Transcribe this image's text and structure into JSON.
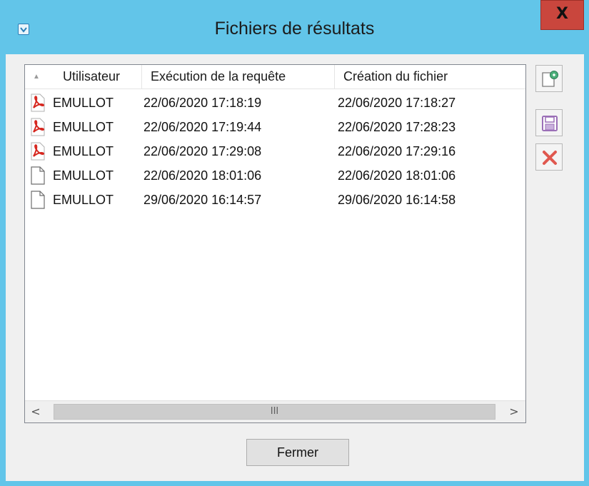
{
  "window": {
    "title": "Fichiers de résultats",
    "close_label": "X",
    "icon": "app-icon"
  },
  "list": {
    "columns": [
      "Utilisateur",
      "Exécution de la requête",
      "Création du fichier"
    ],
    "sort_indicator": "▲",
    "rows": [
      {
        "icon": "pdf-file-icon",
        "user": "EMULLOT",
        "execution": "22/06/2020 17:18:19",
        "creation": "22/06/2020 17:18:27"
      },
      {
        "icon": "pdf-file-icon",
        "user": "EMULLOT",
        "execution": "22/06/2020 17:19:44",
        "creation": "22/06/2020 17:28:23"
      },
      {
        "icon": "pdf-file-icon",
        "user": "EMULLOT",
        "execution": "22/06/2020 17:29:08",
        "creation": "22/06/2020 17:29:16"
      },
      {
        "icon": "blank-file-icon",
        "user": "EMULLOT",
        "execution": "22/06/2020 18:01:06",
        "creation": "22/06/2020 18:01:06"
      },
      {
        "icon": "blank-file-icon",
        "user": "EMULLOT",
        "execution": "29/06/2020 16:14:57",
        "creation": "29/06/2020 16:14:58"
      }
    ]
  },
  "scrollbar": {
    "left_arrow": "<",
    "right_arrow": ">",
    "thumb_grip": "III"
  },
  "toolbar": {
    "buttons": [
      "open-file-icon",
      "save-icon",
      "delete-icon"
    ]
  },
  "footer": {
    "close_button_label": "Fermer"
  },
  "colors": {
    "titlebar": "#62c5e9",
    "close_button": "#c9463d",
    "pdf_red": "#d6261e",
    "delete_red": "#e0584f",
    "save_purple": "#9b6fb7"
  }
}
